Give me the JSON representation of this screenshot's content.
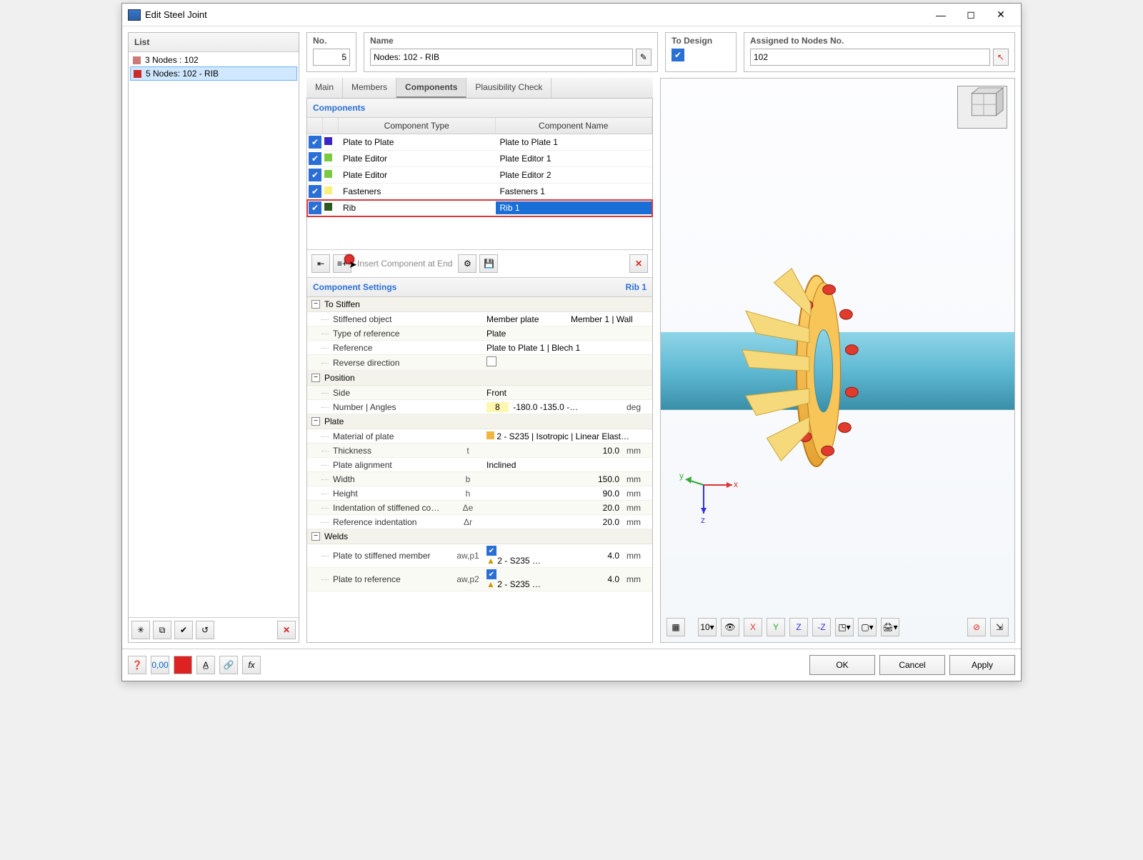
{
  "window": {
    "title": "Edit Steel Joint"
  },
  "list": {
    "title": "List",
    "items": [
      {
        "color": "#cc7a7a",
        "label": "3  Nodes : 102"
      },
      {
        "color": "#cc2b2b",
        "label": "5  Nodes: 102 - RIB"
      }
    ],
    "selected": 1
  },
  "fields": {
    "no_label": "No.",
    "no_value": "5",
    "name_label": "Name",
    "name_value": "Nodes: 102 - RIB",
    "todesign_label": "To Design",
    "nodes_label": "Assigned to Nodes No.",
    "nodes_value": "102"
  },
  "tabs": {
    "items": [
      "Main",
      "Members",
      "Components",
      "Plausibility Check"
    ],
    "active": 2
  },
  "components": {
    "title": "Components",
    "headers": {
      "type": "Component Type",
      "name": "Component Name"
    },
    "rows": [
      {
        "chk": true,
        "color": "#3a23c9",
        "type": "Plate to Plate",
        "name": "Plate to Plate 1"
      },
      {
        "chk": true,
        "color": "#7ac943",
        "type": "Plate Editor",
        "name": "Plate Editor 1"
      },
      {
        "chk": true,
        "color": "#7ac943",
        "type": "Plate Editor",
        "name": "Plate Editor 2"
      },
      {
        "chk": true,
        "color": "#f7f07a",
        "type": "Fasteners",
        "name": "Fasteners 1"
      },
      {
        "chk": true,
        "color": "#2e5a1f",
        "type": "Rib",
        "name": "Rib 1"
      }
    ],
    "selected": 4,
    "insert_placeholder": "Insert Component at End"
  },
  "settings": {
    "title": "Component Settings",
    "current": "Rib 1",
    "groups": {
      "stiffen": {
        "title": "To Stiffen",
        "rows": [
          {
            "label": "Stiffened object",
            "val": "Member plate",
            "extra": "Member 1 | Wall"
          },
          {
            "label": "Type of reference",
            "val": "Plate"
          },
          {
            "label": "Reference",
            "val": "Plate to Plate 1 | Blech 1"
          },
          {
            "label": "Reverse direction",
            "check": true
          }
        ]
      },
      "position": {
        "title": "Position",
        "rows": [
          {
            "label": "Side",
            "val": "Front"
          },
          {
            "label": "Number | Angles",
            "numhl": "8",
            "val2": "-180.0 -135.0 -…",
            "unit": "deg"
          }
        ]
      },
      "plate": {
        "title": "Plate",
        "rows": [
          {
            "label": "Material of plate",
            "swatch": "#f2b541",
            "val": "2 - S235 | Isotropic | Linear Elast…"
          },
          {
            "label": "Thickness",
            "sym": "t",
            "num": "10.0",
            "unit": "mm"
          },
          {
            "label": "Plate alignment",
            "val": "Inclined"
          },
          {
            "label": "Width",
            "sym": "b",
            "num": "150.0",
            "unit": "mm"
          },
          {
            "label": "Height",
            "sym": "h",
            "num": "90.0",
            "unit": "mm"
          },
          {
            "label": "Indentation of stiffened co…",
            "sym": "Δe",
            "num": "20.0",
            "unit": "mm"
          },
          {
            "label": "Reference indentation",
            "sym": "Δr",
            "num": "20.0",
            "unit": "mm"
          }
        ]
      },
      "welds": {
        "title": "Welds",
        "rows": [
          {
            "label": "Plate to stiffened member",
            "sym": "aw,p1",
            "chk": true,
            "mat": "2 - S235 …",
            "num": "4.0",
            "unit": "mm"
          },
          {
            "label": "Plate to reference",
            "sym": "aw,p2",
            "chk": true,
            "mat": "2 - S235 …",
            "num": "4.0",
            "unit": "mm"
          }
        ]
      }
    }
  },
  "footer": {
    "ok": "OK",
    "cancel": "Cancel",
    "apply": "Apply"
  },
  "axes": {
    "x": "x",
    "y": "y",
    "z": "z"
  }
}
